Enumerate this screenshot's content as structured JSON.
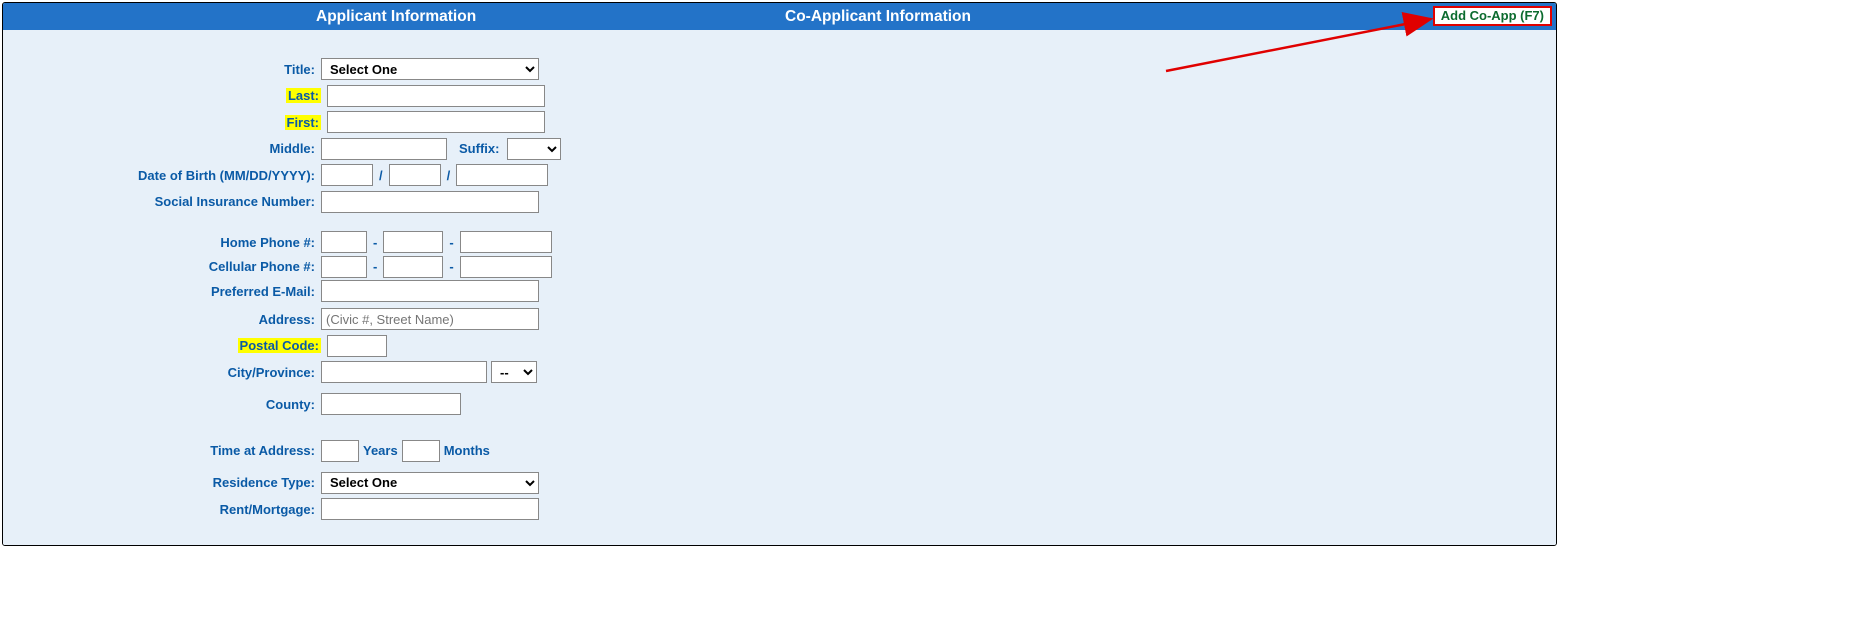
{
  "header": {
    "applicant_title": "Applicant Information",
    "coapplicant_title": "Co-Applicant Information",
    "add_coapp_label": "Add Co-App  (F7)"
  },
  "labels": {
    "title": "Title:",
    "last": "Last:",
    "first": "First:",
    "middle": "Middle:",
    "suffix": "Suffix:",
    "dob": "Date of Birth (MM/DD/YYYY):",
    "sin": "Social Insurance Number:",
    "home_phone": "Home Phone #:",
    "cell_phone": "Cellular Phone #:",
    "email": "Preferred E-Mail:",
    "address": "Address:",
    "postal": "Postal Code:",
    "city_prov": "City/Province:",
    "county": "County:",
    "time_addr": "Time at Address:",
    "years": "Years",
    "months": "Months",
    "residence_type": "Residence Type:",
    "rent_mortgage": "Rent/Mortgage:"
  },
  "options": {
    "title_default": "Select One",
    "province_default": "--",
    "residence_default": "Select One"
  },
  "placeholders": {
    "address": "(Civic #, Street Name)"
  },
  "sep": {
    "slash": "/",
    "dash": "-"
  }
}
